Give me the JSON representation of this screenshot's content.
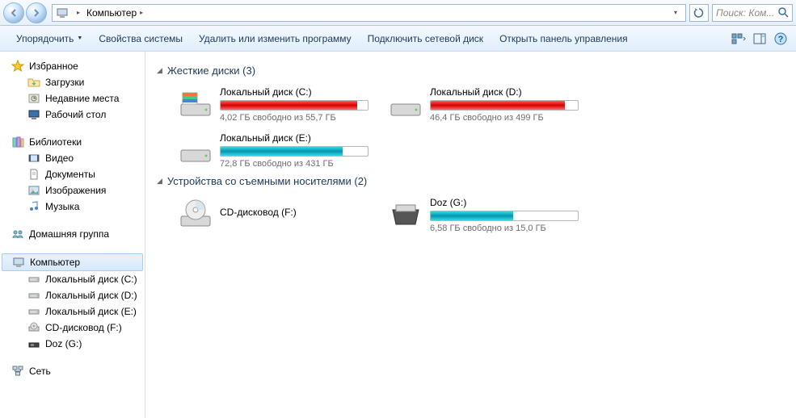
{
  "nav": {
    "location": "Компьютер",
    "search_placeholder": "Поиск: Ком..."
  },
  "toolbar": {
    "organize": "Упорядочить",
    "props": "Свойства системы",
    "uninstall": "Удалить или изменить программу",
    "mapnet": "Подключить сетевой диск",
    "cpanel": "Открыть панель управления"
  },
  "sidebar": {
    "favorites": {
      "label": "Избранное",
      "items": [
        "Загрузки",
        "Недавние места",
        "Рабочий стол"
      ]
    },
    "libraries": {
      "label": "Библиотеки",
      "items": [
        "Видео",
        "Документы",
        "Изображения",
        "Музыка"
      ]
    },
    "homegroup": {
      "label": "Домашняя группа"
    },
    "computer": {
      "label": "Компьютер",
      "items": [
        "Локальный диск (C:)",
        "Локальный диск (D:)",
        "Локальный диск (E:)",
        "CD-дисковод (F:)",
        "Doz (G:)"
      ]
    },
    "network": {
      "label": "Сеть"
    }
  },
  "content": {
    "hdd_header": "Жесткие диски (3)",
    "removable_header": "Устройства со съемными носителями (2)",
    "drives": {
      "c": {
        "name": "Локальный диск (C:)",
        "info": "4,02 ГБ свободно из 55,7 ГБ",
        "pct": 93,
        "color": "red"
      },
      "d": {
        "name": "Локальный диск (D:)",
        "info": "46,4 ГБ свободно из 499 ГБ",
        "pct": 91,
        "color": "red"
      },
      "e": {
        "name": "Локальный диск (E:)",
        "info": "72,8 ГБ свободно из 431 ГБ",
        "pct": 83,
        "color": "teal"
      },
      "f": {
        "name": "CD-дисковод (F:)"
      },
      "g": {
        "name": "Doz (G:)",
        "info": "6,58 ГБ свободно из 15,0 ГБ",
        "pct": 56,
        "color": "teal"
      }
    }
  }
}
